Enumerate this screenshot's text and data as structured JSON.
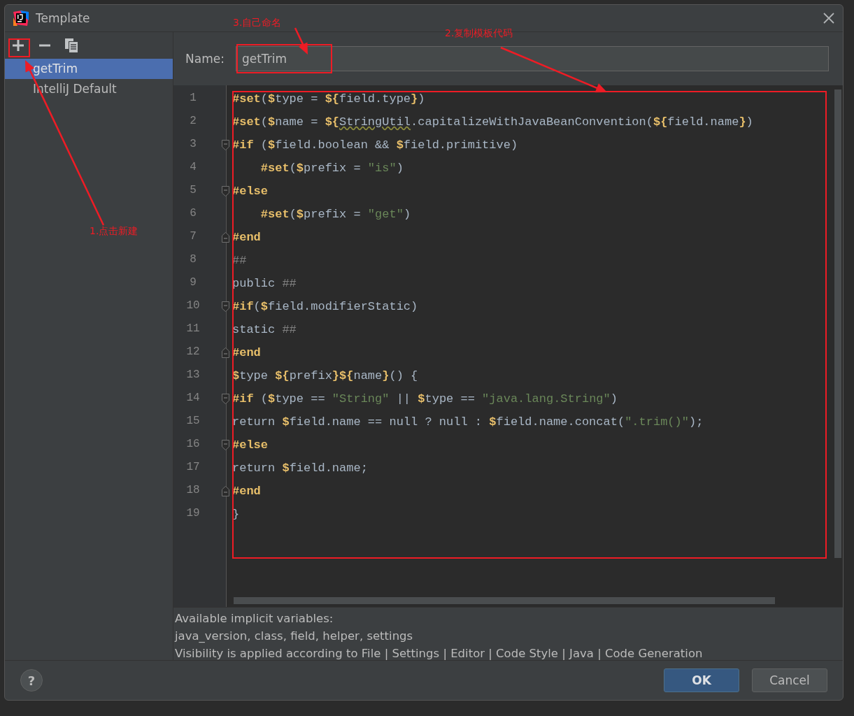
{
  "window": {
    "title": "Template"
  },
  "templates": [
    {
      "label": "getTrim",
      "selected": true
    },
    {
      "label": "IntelliJ Default",
      "selected": false
    }
  ],
  "name_field": {
    "label": "Name:",
    "value": "getTrim"
  },
  "editor": {
    "lines": [
      {
        "number": "1",
        "kind": "plain",
        "tokens": [
          {
            "kind": "d",
            "t": "#set"
          },
          {
            "kind": "p",
            "t": "("
          },
          {
            "kind": "v",
            "t": "$"
          },
          {
            "kind": "p",
            "t": "type = "
          },
          {
            "kind": "v",
            "t": "${"
          },
          {
            "kind": "p",
            "t": "field.type"
          },
          {
            "kind": "v",
            "t": "}"
          },
          {
            "kind": "p",
            "t": ")"
          }
        ]
      },
      {
        "number": "2",
        "kind": "plain",
        "tokens": [
          {
            "kind": "d",
            "t": "#set"
          },
          {
            "kind": "p",
            "t": "("
          },
          {
            "kind": "v",
            "t": "$"
          },
          {
            "kind": "p",
            "t": "name = "
          },
          {
            "kind": "v",
            "t": "${"
          },
          {
            "kind": "u",
            "t": "StringUtil"
          },
          {
            "kind": "p",
            "t": ".capitalizeWithJavaBeanConvention("
          },
          {
            "kind": "v",
            "t": "${"
          },
          {
            "kind": "p",
            "t": "field.name"
          },
          {
            "kind": "v",
            "t": "}"
          },
          {
            "kind": "p",
            "t": ")"
          }
        ]
      },
      {
        "number": "3",
        "kind": "fold_start",
        "tokens": [
          {
            "kind": "d",
            "t": "#if"
          },
          {
            "kind": "p",
            "t": " ("
          },
          {
            "kind": "v",
            "t": "$"
          },
          {
            "kind": "p",
            "t": "field.boolean && "
          },
          {
            "kind": "v",
            "t": "$"
          },
          {
            "kind": "p",
            "t": "field.primitive)"
          }
        ]
      },
      {
        "number": "4",
        "kind": "plain",
        "tokens": [
          {
            "kind": "d",
            "t": "    #set"
          },
          {
            "kind": "p",
            "t": "("
          },
          {
            "kind": "v",
            "t": "$"
          },
          {
            "kind": "p",
            "t": "prefix = "
          },
          {
            "kind": "s",
            "t": "\"is\""
          },
          {
            "kind": "p",
            "t": ")"
          }
        ]
      },
      {
        "number": "5",
        "kind": "fold_start",
        "tokens": [
          {
            "kind": "d",
            "t": "#else"
          }
        ]
      },
      {
        "number": "6",
        "kind": "plain",
        "tokens": [
          {
            "kind": "d",
            "t": "    #set"
          },
          {
            "kind": "p",
            "t": "("
          },
          {
            "kind": "v",
            "t": "$"
          },
          {
            "kind": "p",
            "t": "prefix = "
          },
          {
            "kind": "s",
            "t": "\"get\""
          },
          {
            "kind": "p",
            "t": ")"
          }
        ]
      },
      {
        "number": "7",
        "kind": "fold_end",
        "tokens": [
          {
            "kind": "d",
            "t": "#end"
          }
        ]
      },
      {
        "number": "8",
        "kind": "plain",
        "tokens": [
          {
            "kind": "c",
            "t": "##"
          }
        ]
      },
      {
        "number": "9",
        "kind": "plain",
        "tokens": [
          {
            "kind": "p",
            "t": "public "
          },
          {
            "kind": "c",
            "t": "##"
          }
        ]
      },
      {
        "number": "10",
        "kind": "fold_start",
        "tokens": [
          {
            "kind": "d",
            "t": "#if"
          },
          {
            "kind": "p",
            "t": "("
          },
          {
            "kind": "v",
            "t": "$"
          },
          {
            "kind": "p",
            "t": "field.modifierStatic)"
          }
        ]
      },
      {
        "number": "11",
        "kind": "plain",
        "tokens": [
          {
            "kind": "p",
            "t": "static "
          },
          {
            "kind": "c",
            "t": "##"
          }
        ]
      },
      {
        "number": "12",
        "kind": "fold_end",
        "tokens": [
          {
            "kind": "d",
            "t": "#end"
          }
        ]
      },
      {
        "number": "13",
        "kind": "plain",
        "tokens": [
          {
            "kind": "v",
            "t": "$"
          },
          {
            "kind": "p",
            "t": "type "
          },
          {
            "kind": "v",
            "t": "${"
          },
          {
            "kind": "p",
            "t": "prefix"
          },
          {
            "kind": "v",
            "t": "}${"
          },
          {
            "kind": "p",
            "t": "name"
          },
          {
            "kind": "v",
            "t": "}"
          },
          {
            "kind": "p",
            "t": "() {"
          }
        ]
      },
      {
        "number": "14",
        "kind": "fold_start",
        "tokens": [
          {
            "kind": "d",
            "t": "#if"
          },
          {
            "kind": "p",
            "t": " ("
          },
          {
            "kind": "v",
            "t": "$"
          },
          {
            "kind": "p",
            "t": "type == "
          },
          {
            "kind": "s",
            "t": "\"String\""
          },
          {
            "kind": "p",
            "t": " || "
          },
          {
            "kind": "v",
            "t": "$"
          },
          {
            "kind": "p",
            "t": "type == "
          },
          {
            "kind": "s",
            "t": "\"java.lang.String\""
          },
          {
            "kind": "p",
            "t": ")"
          }
        ]
      },
      {
        "number": "15",
        "kind": "plain",
        "tokens": [
          {
            "kind": "p",
            "t": "return "
          },
          {
            "kind": "v",
            "t": "$"
          },
          {
            "kind": "p",
            "t": "field.name == null ? null : "
          },
          {
            "kind": "v",
            "t": "$"
          },
          {
            "kind": "p",
            "t": "field.name.concat("
          },
          {
            "kind": "s",
            "t": "\".trim()\""
          },
          {
            "kind": "p",
            "t": ");"
          }
        ]
      },
      {
        "number": "16",
        "kind": "fold_start",
        "tokens": [
          {
            "kind": "d",
            "t": "#else"
          }
        ]
      },
      {
        "number": "17",
        "kind": "plain",
        "tokens": [
          {
            "kind": "p",
            "t": "return "
          },
          {
            "kind": "v",
            "t": "$"
          },
          {
            "kind": "p",
            "t": "field.name;"
          }
        ]
      },
      {
        "number": "18",
        "kind": "fold_end",
        "tokens": [
          {
            "kind": "d",
            "t": "#end"
          }
        ]
      },
      {
        "number": "19",
        "kind": "plain",
        "tokens": [
          {
            "kind": "p",
            "t": "}"
          }
        ]
      }
    ]
  },
  "info": {
    "lines": [
      "Available implicit variables:",
      "java_version, class, field, helper, settings",
      "Visibility is applied according to File | Settings | Editor | Code Style | Java | Code Generation"
    ]
  },
  "help_button": "?",
  "buttons": [
    {
      "label": "OK",
      "kind": "primary"
    },
    {
      "label": "Cancel",
      "kind": "secondary"
    }
  ],
  "annotations": [
    {
      "label": "1.点击新建"
    },
    {
      "label": "2.复制模板代码"
    },
    {
      "label": "3.自己命名"
    }
  ]
}
